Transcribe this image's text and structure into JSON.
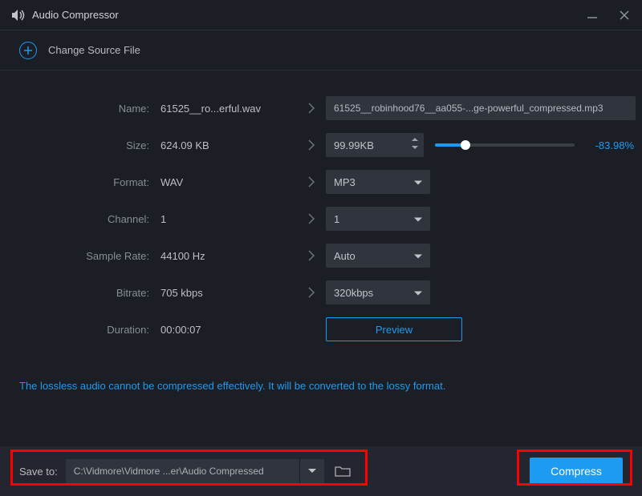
{
  "window": {
    "title": "Audio Compressor"
  },
  "source": {
    "change_label": "Change Source File"
  },
  "form": {
    "name": {
      "label": "Name:",
      "value": "61525__ro...erful.wav",
      "output": "61525__robinhood76__aa055-...ge-powerful_compressed.mp3"
    },
    "size": {
      "label": "Size:",
      "value": "624.09 KB",
      "stepper_value": "99.99KB",
      "percent": "-83.98%"
    },
    "format": {
      "label": "Format:",
      "value": "WAV",
      "selected": "MP3"
    },
    "channel": {
      "label": "Channel:",
      "value": "1",
      "selected": "1"
    },
    "sample_rate": {
      "label": "Sample Rate:",
      "value": "44100 Hz",
      "selected": "Auto"
    },
    "bitrate": {
      "label": "Bitrate:",
      "value": "705 kbps",
      "selected": "320kbps"
    },
    "duration": {
      "label": "Duration:",
      "value": "00:00:07"
    },
    "preview_label": "Preview"
  },
  "notice": "The lossless audio cannot be compressed effectively. It will be converted to the lossy format.",
  "bottom": {
    "save_label": "Save to:",
    "save_path": "C:\\Vidmore\\Vidmore ...er\\Audio Compressed",
    "compress_label": "Compress"
  }
}
